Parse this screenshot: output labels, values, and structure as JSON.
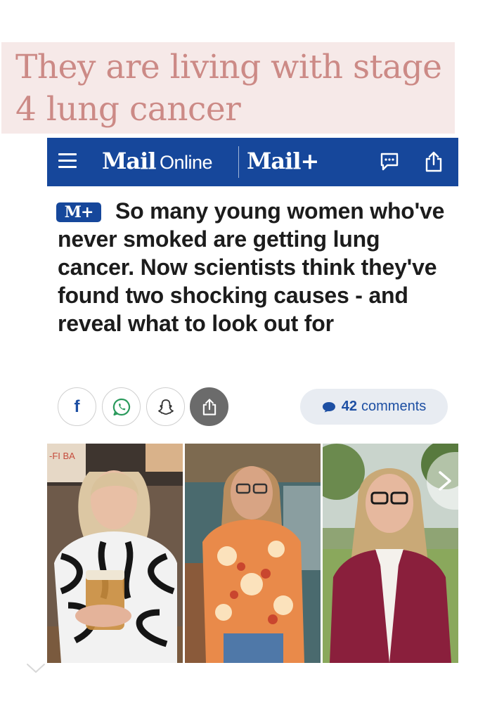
{
  "overlay": {
    "title": "They are living with stage 4 lung cancer"
  },
  "header": {
    "logo_mail": "Mail",
    "logo_online": "Online",
    "logo_mailplus": "Mail+",
    "icons": [
      "menu-icon",
      "comment-icon",
      "share-icon"
    ]
  },
  "article": {
    "badge": "M+",
    "headline": "So many young women who've never smoked are getting lung cancer. Now scientists think they've found two shocking causes - and reveal what to look out for"
  },
  "share": {
    "facebook_glyph": "f",
    "buttons": [
      "facebook-icon",
      "whatsapp-icon",
      "snapchat-icon",
      "share-icon"
    ]
  },
  "comments": {
    "count": "42",
    "label": "comments"
  },
  "gallery": {
    "photos": [
      "woman-zebra-top-with-beer",
      "woman-floral-shirt-glasses",
      "woman-burgundy-blazer-glasses"
    ],
    "sign_text": "-FI BA"
  },
  "colors": {
    "brand_blue": "#16479b",
    "overlay_bg": "#f6e9e8",
    "overlay_text": "#cc8a86",
    "pill_bg": "#e8ecf2"
  }
}
